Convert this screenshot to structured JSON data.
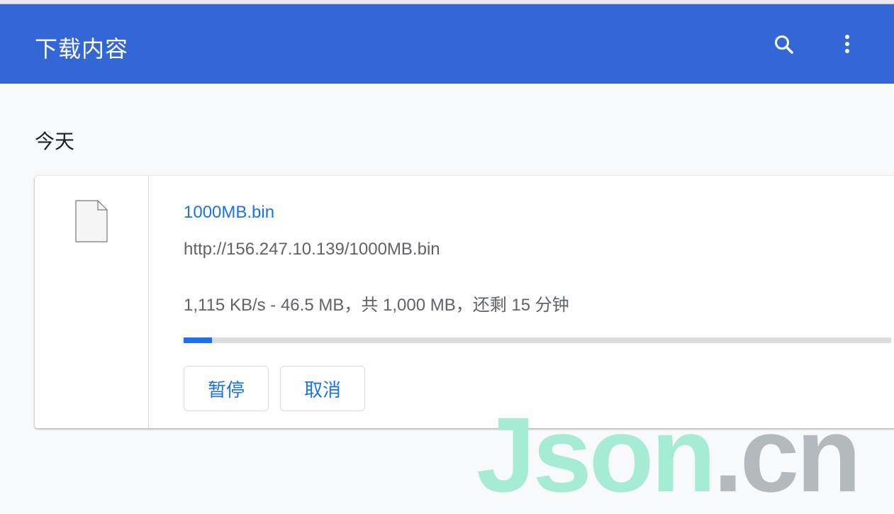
{
  "toolbar": {
    "title": "下载内容",
    "search_icon": "search-icon",
    "menu_icon": "more-vert-icon",
    "color": "#3367d6"
  },
  "section": {
    "title": "今天"
  },
  "download": {
    "file_icon": "file-icon",
    "file_name": "1000MB.bin",
    "url": "http://156.247.10.139/1000MB.bin",
    "status": "1,115 KB/s - 46.5 MB，共 1,000 MB，还剩 15 分钟",
    "progress_percent": 4,
    "accent_color": "#1a73e8",
    "pause_label": "暂停",
    "cancel_label": "取消"
  },
  "watermark": {
    "part1": "Json",
    "part2": ".cn"
  }
}
